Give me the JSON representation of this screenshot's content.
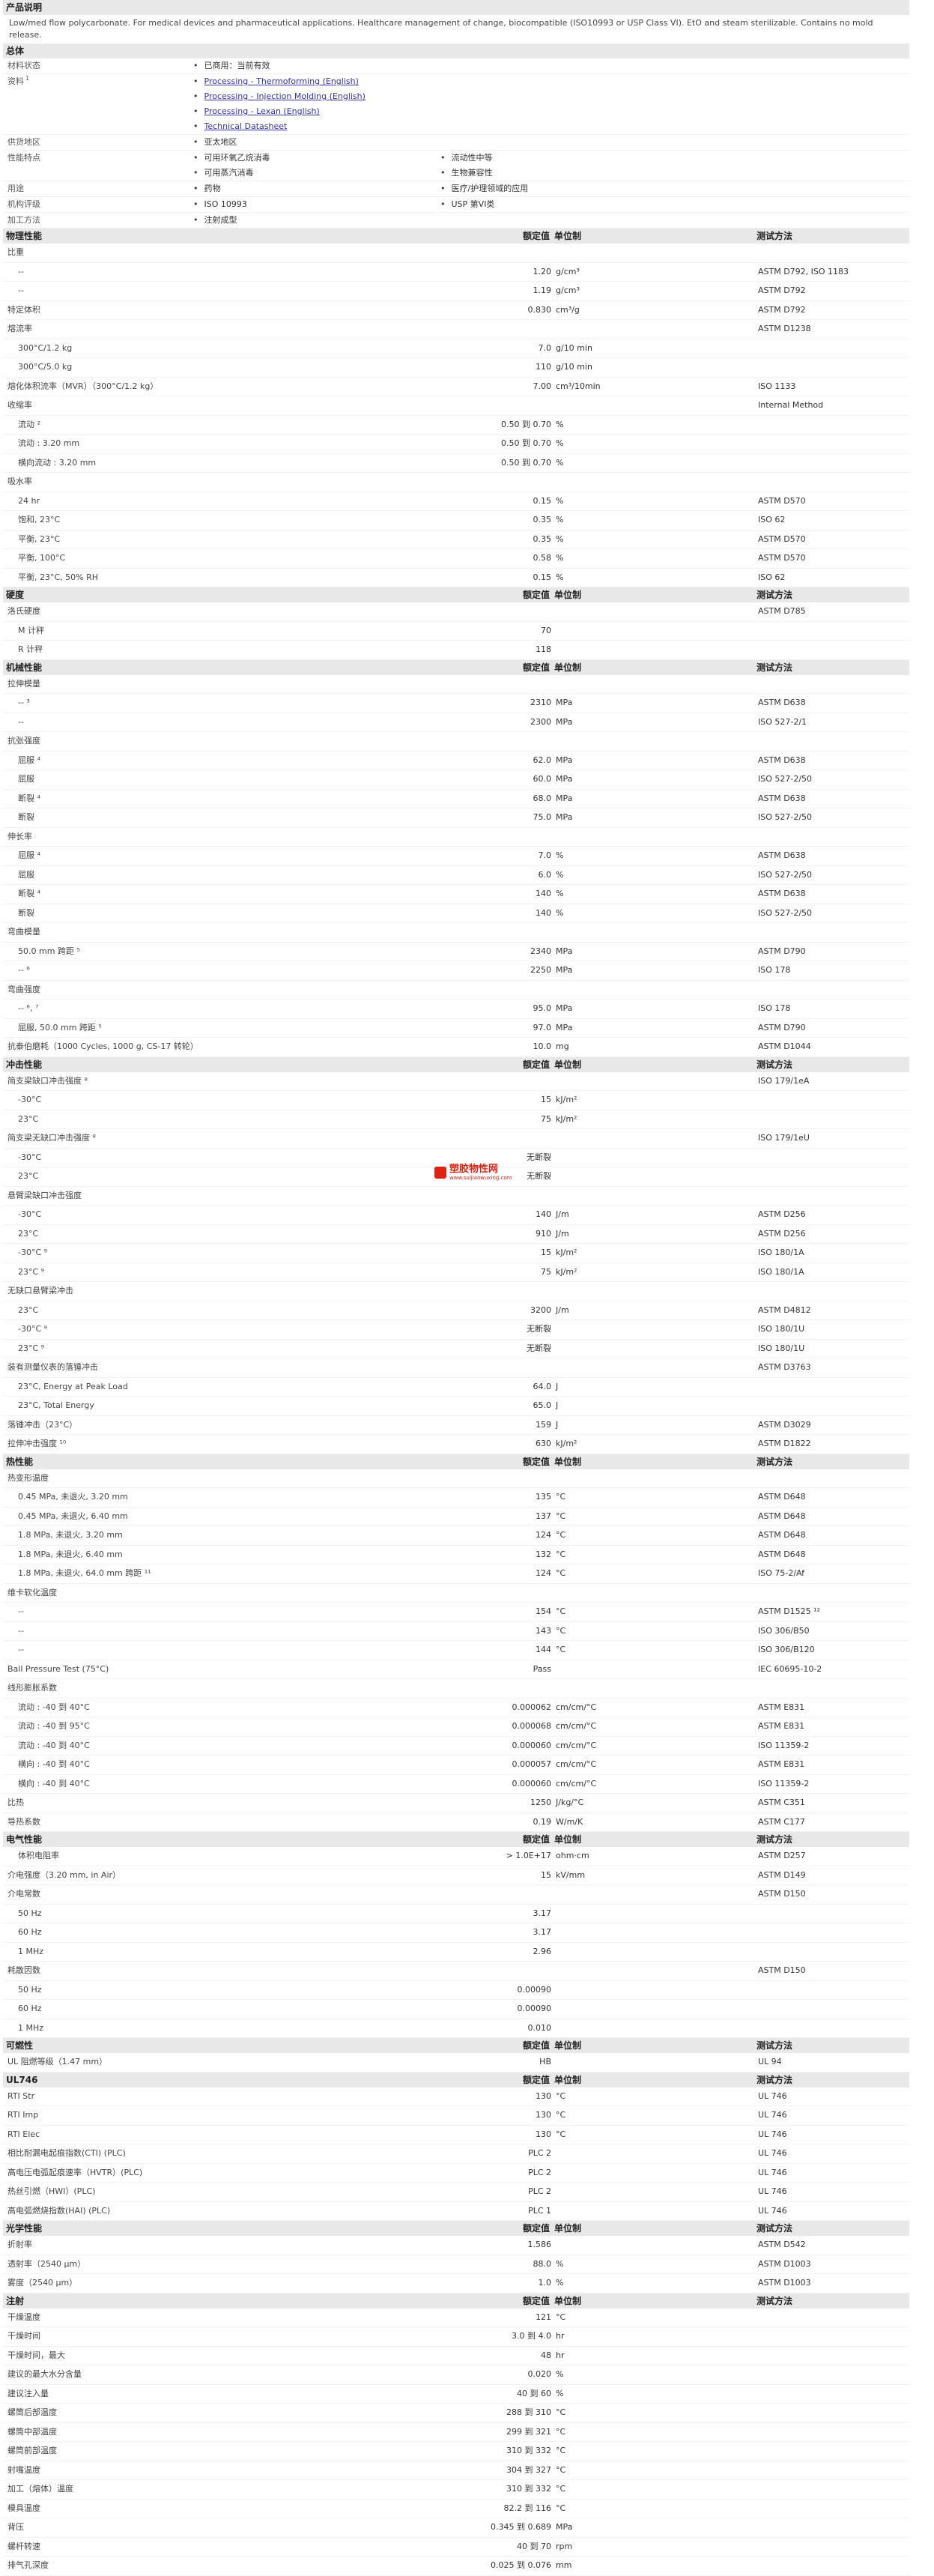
{
  "h_desc": "产品说明",
  "desc": "Low/med flow polycarbonate. For medical devices and pharmaceutical applications. Healthcare management of change, biocompatible (ISO10993 or USP Class VI). EtO and steam sterilizable. Contains no mold release.",
  "h_gen": "总体",
  "gen": {
    "status_lbl": "材料状态",
    "status": "已商用：当前有效",
    "docs_lbl": "资料",
    "docs_sup": "1",
    "docs": [
      "Processing - Thermoforming (English)",
      "Processing - Injection Molding (English)",
      "Processing - Lexan (English)",
      "Technical Datasheet"
    ],
    "region_lbl": "供货地区",
    "region": "亚太地区",
    "feat_lbl": "性能特点",
    "feat_a": [
      "可用环氧乙烷消毒",
      "可用蒸汽消毒"
    ],
    "feat_b": [
      "流动性中等",
      "生物兼容性"
    ],
    "use_lbl": "用途",
    "use_a": "药物",
    "use_b": "医疗/护理领域的应用",
    "agency_lbl": "机构评级",
    "agency_a": "ISO 10993",
    "agency_b": "USP 第VI类",
    "proc_lbl": "加工方法",
    "proc": "注射成型"
  },
  "hdr": {
    "v": "额定值",
    "u": "单位制",
    "m": "测试方法"
  },
  "sections": [
    {
      "title": "物理性能",
      "hdr": true,
      "rows": [
        [
          "比重",
          "",
          "",
          ""
        ],
        [
          "--",
          "1.20",
          "g/cm³",
          "ASTM D792, ISO 1183",
          1
        ],
        [
          "--",
          "1.19",
          "g/cm³",
          "ASTM D792",
          1
        ],
        [
          "特定体积",
          "0.830",
          "cm³/g",
          "ASTM D792"
        ],
        [
          "熔流率",
          "",
          "",
          "ASTM D1238"
        ],
        [
          "300°C/1.2 kg",
          "7.0",
          "g/10 min",
          "",
          1
        ],
        [
          "300°C/5.0 kg",
          "110",
          "g/10 min",
          "",
          1
        ],
        [
          "熔化体积流率（MVR）（300°C/1.2 kg）",
          "7.00",
          "cm³/10min",
          "ISO 1133"
        ],
        [
          "收缩率",
          "",
          "",
          "Internal Method"
        ],
        [
          "流动 ²",
          "0.50 到 0.70",
          "%",
          "",
          1
        ],
        [
          "流动 : 3.20 mm",
          "0.50 到 0.70",
          "%",
          "",
          1
        ],
        [
          "横向流动 : 3.20 mm",
          "0.50 到 0.70",
          "%",
          "",
          1
        ],
        [
          "吸水率",
          "",
          "",
          ""
        ],
        [
          "24 hr",
          "0.15",
          "%",
          "ASTM D570",
          1
        ],
        [
          "饱和, 23°C",
          "0.35",
          "%",
          "ISO 62",
          1
        ],
        [
          "平衡, 23°C",
          "0.35",
          "%",
          "ASTM D570",
          1
        ],
        [
          "平衡, 100°C",
          "0.58",
          "%",
          "ASTM D570",
          1
        ],
        [
          "平衡, 23°C, 50% RH",
          "0.15",
          "%",
          "ISO 62",
          1
        ]
      ]
    },
    {
      "title": "硬度",
      "hdr": true,
      "rows": [
        [
          "洛氏硬度",
          "",
          "",
          "ASTM D785"
        ],
        [
          "M 计秤",
          "70",
          "",
          "",
          1
        ],
        [
          "R 计秤",
          "118",
          "",
          "",
          1
        ]
      ]
    },
    {
      "title": "机械性能",
      "hdr": true,
      "rows": [
        [
          "拉伸模量",
          "",
          "",
          ""
        ],
        [
          "-- ³",
          "2310",
          "MPa",
          "ASTM D638",
          1
        ],
        [
          "--",
          "2300",
          "MPa",
          "ISO 527-2/1",
          1
        ],
        [
          "抗张强度",
          "",
          "",
          ""
        ],
        [
          "屈服 ⁴",
          "62.0",
          "MPa",
          "ASTM D638",
          1
        ],
        [
          "屈服",
          "60.0",
          "MPa",
          "ISO 527-2/50",
          1
        ],
        [
          "断裂 ⁴",
          "68.0",
          "MPa",
          "ASTM D638",
          1
        ],
        [
          "断裂",
          "75.0",
          "MPa",
          "ISO 527-2/50",
          1
        ],
        [
          "伸长率",
          "",
          "",
          ""
        ],
        [
          "屈服 ⁴",
          "7.0",
          "%",
          "ASTM D638",
          1
        ],
        [
          "屈服",
          "6.0",
          "%",
          "ISO 527-2/50",
          1
        ],
        [
          "断裂 ⁴",
          "140",
          "%",
          "ASTM D638",
          1
        ],
        [
          "断裂",
          "140",
          "%",
          "ISO 527-2/50",
          1
        ],
        [
          "弯曲模量",
          "",
          "",
          ""
        ],
        [
          "50.0 mm 跨距 ⁵",
          "2340",
          "MPa",
          "ASTM D790",
          1
        ],
        [
          "-- ⁶",
          "2250",
          "MPa",
          "ISO 178",
          1
        ],
        [
          "弯曲强度",
          "",
          "",
          ""
        ],
        [
          "-- ⁶, ⁷",
          "95.0",
          "MPa",
          "ISO 178",
          1
        ],
        [
          "屈服, 50.0 mm 跨距 ⁵",
          "97.0",
          "MPa",
          "ASTM D790",
          1
        ],
        [
          "抗泰伯磨耗（1000 Cycles, 1000 g, CS-17 转轮）",
          "10.0",
          "mg",
          "ASTM D1044"
        ]
      ]
    },
    {
      "title": "冲击性能",
      "hdr": true,
      "rows": [
        [
          "简支梁缺口冲击强度 ⁸",
          "",
          "",
          "ISO 179/1eA"
        ],
        [
          "-30°C",
          "15",
          "kJ/m²",
          "",
          1
        ],
        [
          "23°C",
          "75",
          "kJ/m²",
          "",
          1
        ],
        [
          "简支梁无缺口冲击强度 ⁸",
          "",
          "",
          "ISO 179/1eU"
        ],
        [
          "-30°C",
          "无断裂",
          "",
          "",
          1
        ],
        [
          "23°C",
          "无断裂",
          "",
          "",
          1
        ],
        [
          "悬臂梁缺口冲击强度",
          "",
          "",
          ""
        ],
        [
          "-30°C",
          "140",
          "J/m",
          "ASTM D256",
          1
        ],
        [
          "23°C",
          "910",
          "J/m",
          "ASTM D256",
          1
        ],
        [
          "-30°C ⁹",
          "15",
          "kJ/m²",
          "ISO 180/1A",
          1
        ],
        [
          "23°C ⁹",
          "75",
          "kJ/m²",
          "ISO 180/1A",
          1
        ],
        [
          "无缺口悬臂梁冲击",
          "",
          "",
          ""
        ],
        [
          "23°C",
          "3200",
          "J/m",
          "ASTM D4812",
          1
        ],
        [
          "-30°C ⁹",
          "无断裂",
          "",
          "ISO 180/1U",
          1
        ],
        [
          "23°C ⁹",
          "无断裂",
          "",
          "ISO 180/1U",
          1
        ],
        [
          "装有测量仪表的落锤冲击",
          "",
          "",
          "ASTM D3763"
        ],
        [
          "23°C, Energy at Peak Load",
          "64.0",
          "J",
          "",
          1
        ],
        [
          "23°C, Total Energy",
          "65.0",
          "J",
          "",
          1
        ],
        [
          "落锤冲击（23°C）",
          "159",
          "J",
          "ASTM D3029"
        ],
        [
          "拉伸冲击强度 ¹⁰",
          "630",
          "kJ/m²",
          "ASTM D1822"
        ]
      ]
    },
    {
      "title": "热性能",
      "hdr": true,
      "rows": [
        [
          "热变形温度",
          "",
          "",
          ""
        ],
        [
          "0.45 MPa, 未退火, 3.20 mm",
          "135",
          "°C",
          "ASTM D648",
          1
        ],
        [
          "0.45 MPa, 未退火, 6.40 mm",
          "137",
          "°C",
          "ASTM D648",
          1
        ],
        [
          "1.8 MPa, 未退火, 3.20 mm",
          "124",
          "°C",
          "ASTM D648",
          1
        ],
        [
          "1.8 MPa, 未退火, 6.40 mm",
          "132",
          "°C",
          "ASTM D648",
          1
        ],
        [
          "1.8 MPa, 未退火, 64.0 mm 跨距 ¹¹",
          "124",
          "°C",
          "ISO 75-2/Af",
          1
        ],
        [
          "维卡软化温度",
          "",
          "",
          ""
        ],
        [
          "--",
          "154",
          "°C",
          "ASTM D1525 ¹²",
          1
        ],
        [
          "--",
          "143",
          "°C",
          "ISO 306/B50",
          1
        ],
        [
          "--",
          "144",
          "°C",
          "ISO 306/B120",
          1
        ],
        [
          "Ball Pressure Test (75°C)",
          "Pass",
          "",
          "IEC 60695-10-2"
        ],
        [
          "线形膨胀系数",
          "",
          "",
          ""
        ],
        [
          "流动 : -40 到 40°C",
          "0.000062",
          "cm/cm/°C",
          "ASTM E831",
          1
        ],
        [
          "流动 : -40 到 95°C",
          "0.000068",
          "cm/cm/°C",
          "ASTM E831",
          1
        ],
        [
          "流动 : -40 到 40°C",
          "0.000060",
          "cm/cm/°C",
          "ISO 11359-2",
          1
        ],
        [
          "横向 : -40 到 40°C",
          "0.000057",
          "cm/cm/°C",
          "ASTM E831",
          1
        ],
        [
          "横向 : -40 到 40°C",
          "0.000060",
          "cm/cm/°C",
          "ISO 11359-2",
          1
        ],
        [
          "比热",
          "1250",
          "J/kg/°C",
          "ASTM C351"
        ],
        [
          "导热系数",
          "0.19",
          "W/m/K",
          "ASTM C177"
        ]
      ]
    },
    {
      "title": "电气性能",
      "hdr": true,
      "rows": [
        [
          "体积电阻率",
          "> 1.0E+17",
          "ohm·cm",
          "ASTM D257",
          1
        ],
        [
          "介电强度（3.20 mm, in Air）",
          "15",
          "kV/mm",
          "ASTM D149"
        ],
        [
          "介电常数",
          "",
          "",
          "ASTM D150"
        ],
        [
          "50 Hz",
          "3.17",
          "",
          "",
          1
        ],
        [
          "60 Hz",
          "3.17",
          "",
          "",
          1
        ],
        [
          "1 MHz",
          "2.96",
          "",
          "",
          1
        ],
        [
          "耗散因数",
          "",
          "",
          "ASTM D150"
        ],
        [
          "50 Hz",
          "0.00090",
          "",
          "",
          1
        ],
        [
          "60 Hz",
          "0.00090",
          "",
          "",
          1
        ],
        [
          "1 MHz",
          "0.010",
          "",
          "",
          1
        ]
      ]
    },
    {
      "title": "可燃性",
      "hdr": true,
      "rows": [
        [
          "UL 阻燃等级（1.47 mm）",
          "HB",
          "",
          "UL 94"
        ]
      ]
    },
    {
      "title": "UL746",
      "hdr": true,
      "rows": [
        [
          "RTI Str",
          "130",
          "°C",
          "UL 746"
        ],
        [
          "RTI Imp",
          "130",
          "°C",
          "UL 746"
        ],
        [
          "RTI Elec",
          "130",
          "°C",
          "UL 746"
        ],
        [
          "相比耐漏电起痕指数(CTI) (PLC)",
          "PLC 2",
          "",
          "UL 746"
        ],
        [
          "高电压电弧起痕速率（HVTR）(PLC)",
          "PLC 2",
          "",
          "UL 746"
        ],
        [
          "热丝引燃（HWI）(PLC)",
          "PLC 2",
          "",
          "UL 746"
        ],
        [
          "高电弧燃烧指数(HAI) (PLC)",
          "PLC 1",
          "",
          "UL 746"
        ]
      ]
    },
    {
      "title": "光学性能",
      "hdr": true,
      "rows": [
        [
          "折射率",
          "1.586",
          "",
          "ASTM D542"
        ],
        [
          "透射率（2540 µm）",
          "88.0",
          "%",
          "ASTM D1003"
        ],
        [
          "雾度（2540 µm）",
          "1.0",
          "%",
          "ASTM D1003"
        ]
      ]
    },
    {
      "title": "注射",
      "hdr": true,
      "rows": [
        [
          "干燥温度",
          "121",
          "°C",
          ""
        ],
        [
          "干燥时间",
          "3.0 到 4.0",
          "hr",
          ""
        ],
        [
          "干燥时间，最大",
          "48",
          "hr",
          ""
        ],
        [
          "建议的最大水分含量",
          "0.020",
          "%",
          ""
        ],
        [
          "建议注入量",
          "40 到 60",
          "%",
          ""
        ],
        [
          "螺筒后部温度",
          "288 到 310",
          "°C",
          ""
        ],
        [
          "螺筒中部温度",
          "299 到 321",
          "°C",
          ""
        ],
        [
          "螺筒前部温度",
          "310 到 332",
          "°C",
          ""
        ],
        [
          "射嘴温度",
          "304 到 327",
          "°C",
          ""
        ],
        [
          "加工（熔体）温度",
          "310 到 332",
          "°C",
          ""
        ],
        [
          "模具温度",
          "82.2 到 116",
          "°C",
          ""
        ],
        [
          "背压",
          "0.345 到 0.689",
          "MPa",
          ""
        ],
        [
          "螺杆转速",
          "40 到 70",
          "rpm",
          ""
        ],
        [
          "排气孔深度",
          "0.025 到 0.076",
          "mm",
          ""
        ]
      ]
    }
  ],
  "watermark": {
    "t1": "塑胶物性网",
    "t2": "www.suljiaowuxing.com"
  }
}
